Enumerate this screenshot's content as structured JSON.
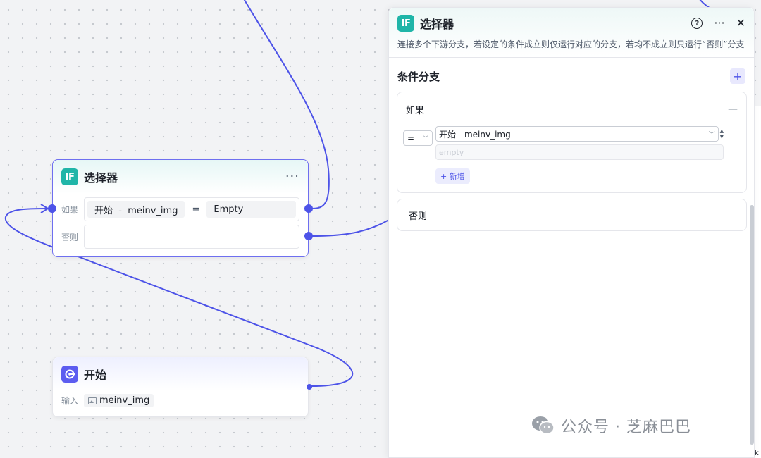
{
  "canvas": {
    "if_node": {
      "title": "选择器",
      "more": "···",
      "if_label": "如果",
      "else_label": "否则",
      "condition": {
        "left": "开始  -  meinv_img",
        "operator": "=",
        "right": "Empty"
      }
    },
    "start_node": {
      "title": "开始",
      "input_label": "输入",
      "input_var": "meinv_img"
    }
  },
  "panel": {
    "title": "选择器",
    "help": "?",
    "more": "···",
    "close": "✕",
    "description": "连接多个下游分支，若设定的条件成立则仅运行对应的分支，若均不成立则只运行“否则”分支",
    "section_title": "条件分支",
    "add": "+",
    "if_card": {
      "label": "如果",
      "collapse": "—",
      "operator": "=",
      "left_value": "开始 - meinv_img",
      "right_placeholder": "empty",
      "add_condition": "+ 新增"
    },
    "else_card": {
      "label": "否则"
    }
  },
  "watermark": {
    "text": "公众号 · 芝麻巴巴"
  },
  "edge_char": "k",
  "colors": {
    "accent": "#4d53e8",
    "if_icon": "#1fb5a8",
    "start_icon": "#5c5cf0"
  },
  "icons": {
    "if": "IF",
    "start": "start-icon",
    "image": "image-icon",
    "wechat": "wechat-icon"
  }
}
